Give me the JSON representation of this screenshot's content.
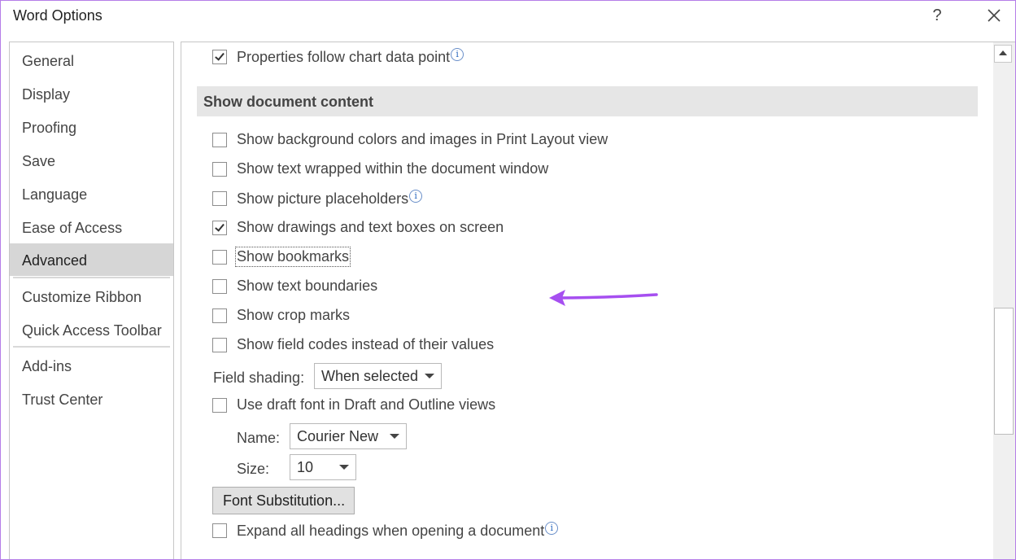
{
  "window": {
    "title": "Word Options",
    "help": "?",
    "accent": "#a64ff0"
  },
  "sidebar": {
    "items": [
      {
        "label": "General"
      },
      {
        "label": "Display"
      },
      {
        "label": "Proofing"
      },
      {
        "label": "Save"
      },
      {
        "label": "Language"
      },
      {
        "label": "Ease of Access"
      },
      {
        "label": "Advanced",
        "selected": true
      },
      {
        "label": "Customize Ribbon"
      },
      {
        "label": "Quick Access Toolbar"
      },
      {
        "label": "Add-ins"
      },
      {
        "label": "Trust Center"
      }
    ]
  },
  "content": {
    "top_option": {
      "label": "Properties follow chart data point",
      "checked": true,
      "info": "i"
    },
    "section_title": "Show document content",
    "options": [
      {
        "label": "Show background colors and images in Print Layout view",
        "checked": false
      },
      {
        "label": "Show text wrapped within the document window",
        "checked": false
      },
      {
        "label": "Show picture placeholders",
        "checked": false,
        "info": "i"
      },
      {
        "label": "Show drawings and text boxes on screen",
        "checked": true
      },
      {
        "label": "Show bookmarks",
        "checked": false
      },
      {
        "label": "Show text boundaries",
        "checked": false
      },
      {
        "label": "Show crop marks",
        "checked": false
      },
      {
        "label": "Show field codes instead of their values",
        "checked": false
      }
    ],
    "field_shading": {
      "label": "Field shading:",
      "value": "When selected"
    },
    "draft_font": {
      "label": "Use draft font in Draft and Outline views",
      "checked": false
    },
    "name": {
      "label": "Name:",
      "value": "Courier New"
    },
    "size": {
      "label": "Size:",
      "value": "10"
    },
    "font_substitution": "Font Substitution...",
    "expand_headings": {
      "label": "Expand all headings when opening a document",
      "checked": false,
      "info": "i"
    }
  }
}
